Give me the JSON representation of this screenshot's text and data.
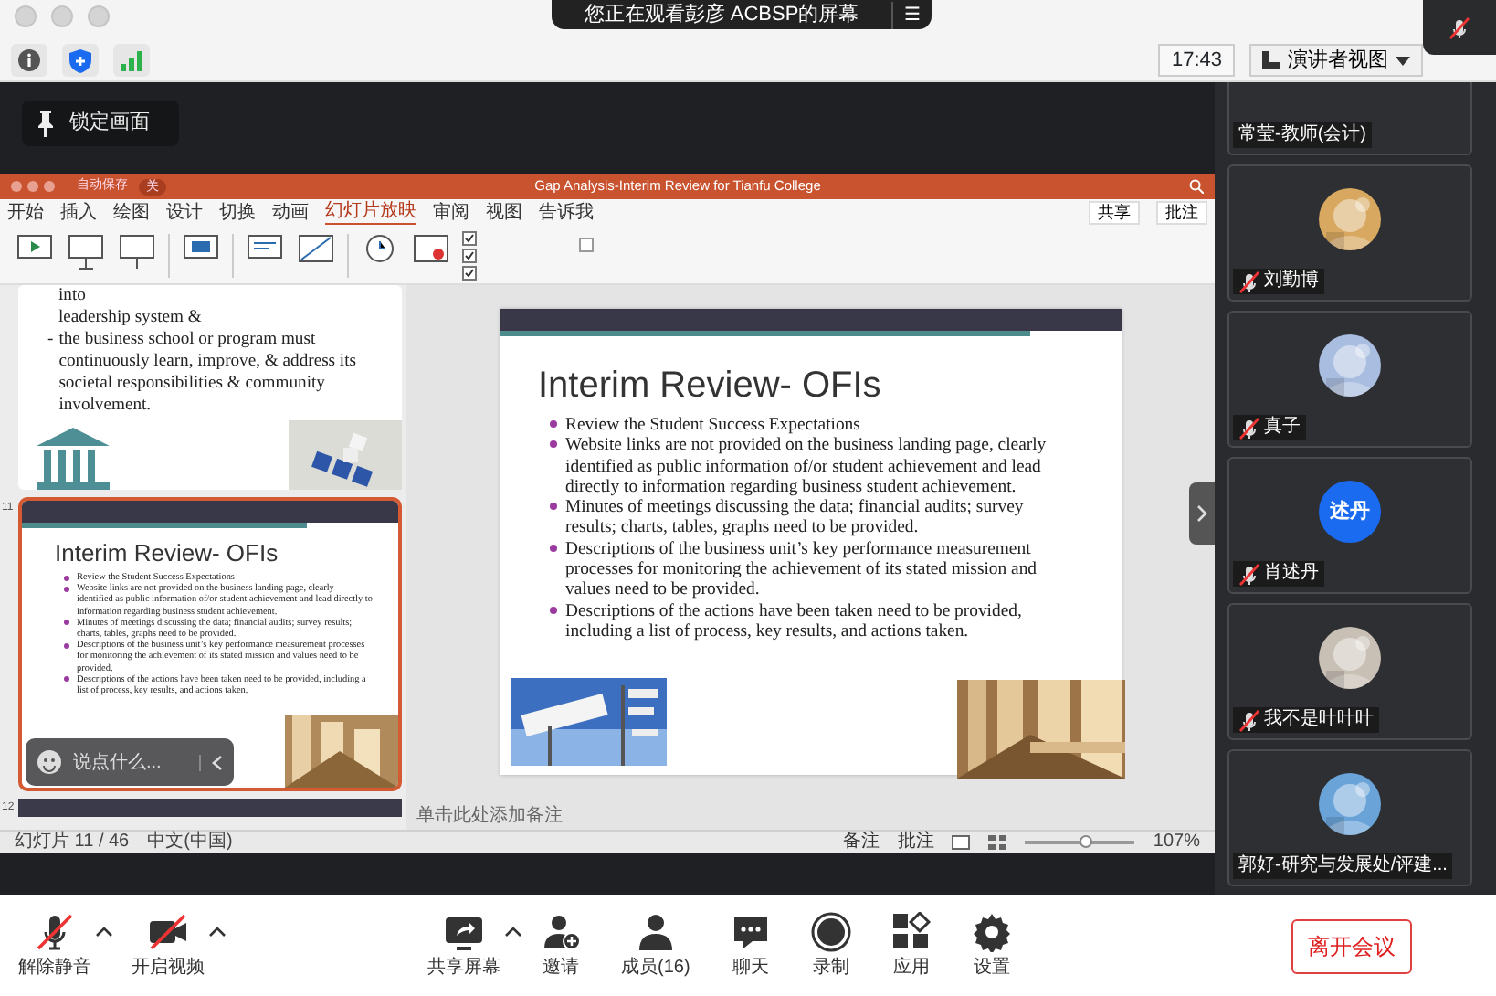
{
  "window": {
    "banner": "您正在观看彭彦 ACBSP的屏幕",
    "banner_menu": "☰"
  },
  "toolbar": {
    "time": "17:43",
    "view_button": "演讲者视图"
  },
  "lock_button": "锁定画面",
  "ppt": {
    "title": "Gap Analysis-Interim Review for Tianfu College",
    "autosave": "自动保存",
    "autosave_state": "关",
    "tabs": [
      {
        "label": "开始",
        "selected": false
      },
      {
        "label": "插入",
        "selected": false
      },
      {
        "label": "绘图",
        "selected": false
      },
      {
        "label": "设计",
        "selected": false
      },
      {
        "label": "切换",
        "selected": false
      },
      {
        "label": "动画",
        "selected": false
      },
      {
        "label": "幻灯片放映",
        "selected": true
      },
      {
        "label": "审阅",
        "selected": false
      },
      {
        "label": "视图",
        "selected": false
      }
    ],
    "tell_me": "告诉我",
    "share": "共享",
    "comments": "批注",
    "thumbnails": [
      {
        "kind": "text",
        "lines": [
          "into",
          "leadership system &"
        ],
        "bullet_mark": "-",
        "bullet": "the business school or program must continuously learn, improve, & address its societal responsibilities & community involvement.",
        "selected": false
      },
      {
        "kind": "slide",
        "number": "11",
        "selected": true,
        "title": "Interim Review- OFIs",
        "bullets": [
          "Review the Student Success Expectations",
          "Website links are not provided on the business landing page, clearly identified as public information of/or student achievement and lead directly to information regarding business student achievement.",
          "Minutes of meetings discussing the data; financial audits; survey results; charts, tables, graphs need to be provided.",
          "Descriptions of the business unit’s key performance measurement processes for monitoring the achievement of its stated mission and values need to be provided.",
          "Descriptions of the actions have been taken need to be provided, including a list of process, key results, and actions taken."
        ]
      },
      {
        "kind": "peek",
        "number": "12",
        "selected": false
      }
    ],
    "slide": {
      "title": "Interim Review- OFIs",
      "bullets": [
        "Review the Student Success Expectations",
        "Website links are not provided on the business landing page, clearly identified as public information of/or student achievement and lead directly to information regarding business student achievement.",
        "Minutes of meetings discussing the data; financial audits; survey results; charts, tables, graphs need to be provided.",
        "Descriptions of the business unit’s key performance measurement processes for monitoring the achievement of its stated mission and values need to be provided.",
        "Descriptions of the actions have been taken need to be provided, including a list of process, key results, and actions taken."
      ]
    },
    "notes_placeholder": "单击此处添加备注",
    "status": {
      "slide": "幻灯片 11 / 46",
      "language": "中文(中国)",
      "notes": "备注",
      "comments": "批注",
      "zoom_slider": {
        "level": 0.55
      },
      "zoom": "107%"
    }
  },
  "chat_overlay": {
    "placeholder": "说点什么..."
  },
  "participants": [
    {
      "name": "常莹-教师(会计)",
      "muted": false
    },
    {
      "name": "刘勤博",
      "muted": true
    },
    {
      "name": "真子",
      "muted": true
    },
    {
      "name": "肖述丹",
      "muted": true,
      "avatar": {
        "kind": "initials",
        "text": "述丹",
        "color": "#1a6bf0"
      }
    },
    {
      "name": "我不是叶叶叶",
      "muted": true
    },
    {
      "name": "郭好-研究与发展处/评建...",
      "muted": false
    }
  ],
  "controls": [
    {
      "kind": "mic",
      "label": "解除静音",
      "off": true,
      "menu": true
    },
    {
      "kind": "video",
      "label": "开启视频",
      "off": true,
      "menu": true
    },
    {
      "kind": "share",
      "label": "共享屏幕",
      "off": false,
      "menu": true
    },
    {
      "kind": "invite",
      "label": "邀请",
      "off": false,
      "menu": false
    },
    {
      "kind": "members",
      "label": "成员(16)",
      "off": false,
      "menu": false
    },
    {
      "kind": "chat",
      "label": "聊天",
      "off": false,
      "menu": false
    },
    {
      "kind": "record",
      "label": "录制",
      "off": false,
      "menu": false
    },
    {
      "kind": "apps",
      "label": "应用",
      "off": false,
      "menu": false
    },
    {
      "kind": "settings",
      "label": "设置",
      "off": false,
      "menu": false
    }
  ],
  "leave_button": "离开会议"
}
